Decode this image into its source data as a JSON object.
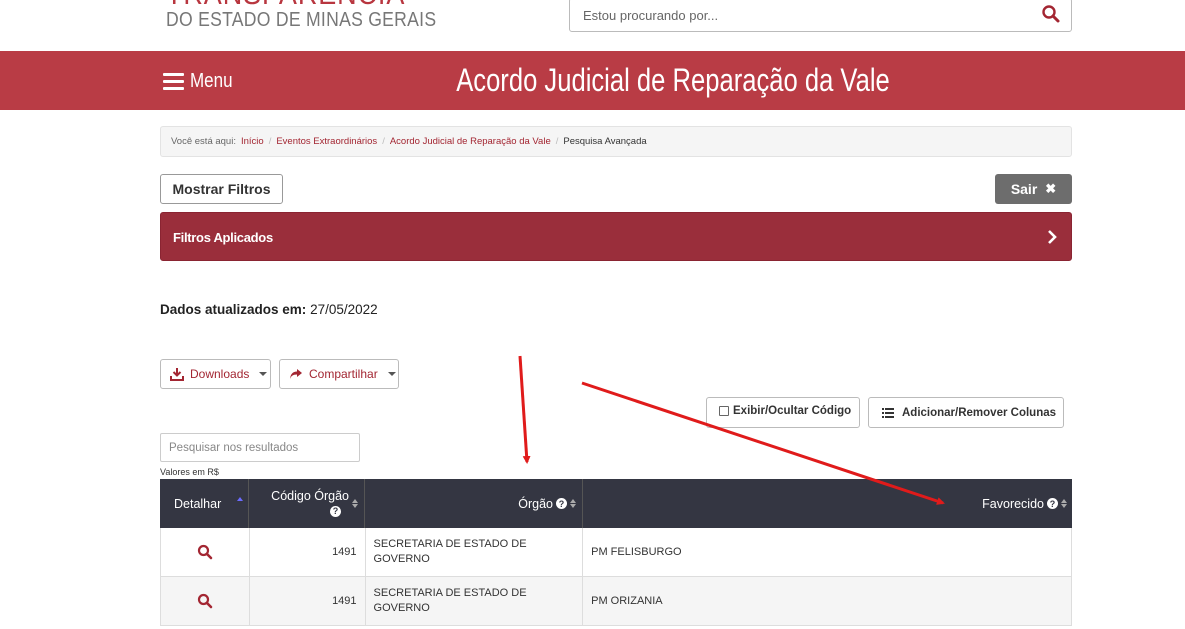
{
  "header": {
    "logo_top": "TRANSPARÊNCIA",
    "logo_sub": "DO ESTADO DE MINAS GERAIS",
    "search_placeholder": "Estou procurando por...",
    "search_icon": "search-icon"
  },
  "redbar": {
    "menu_label": "Menu",
    "title": "Acordo Judicial de Reparação da Vale",
    "background": "#b93c45"
  },
  "breadcrumb": {
    "prefix": "Você está aqui:",
    "items": [
      "Início",
      "Eventos Extraordinários",
      "Acordo Judicial de Reparação da Vale"
    ],
    "active": "Pesquisa Avançada"
  },
  "toolbar": {
    "show_filters": "Mostrar Filtros",
    "exit": "Sair"
  },
  "applied_filters": {
    "label": "Filtros Aplicados",
    "background": "#9a2e3b"
  },
  "updated": {
    "label": "Dados atualizados em:",
    "date": "27/05/2022"
  },
  "actions": {
    "downloads": "Downloads",
    "share": "Compartilhar",
    "toggle_code": "Exibir/Ocultar Código",
    "add_remove_columns": "Adicionar/Remover Colunas"
  },
  "results": {
    "search_placeholder": "Pesquisar nos resultados",
    "currency_note": "Valores em R$"
  },
  "table": {
    "headers": [
      "Detalhar",
      "Código Órgão",
      "Órgão",
      "Favorecido"
    ],
    "rows": [
      {
        "codigo": "1491",
        "orgao": "SECRETARIA DE ESTADO DE GOVERNO",
        "favorecido": "PM FELISBURGO"
      },
      {
        "codigo": "1491",
        "orgao": "SECRETARIA DE ESTADO DE GOVERNO",
        "favorecido": "PM ORIZANIA"
      }
    ]
  },
  "colors": {
    "accent": "#a32632",
    "table_header": "#343642",
    "arrow": "#e01b1b"
  }
}
